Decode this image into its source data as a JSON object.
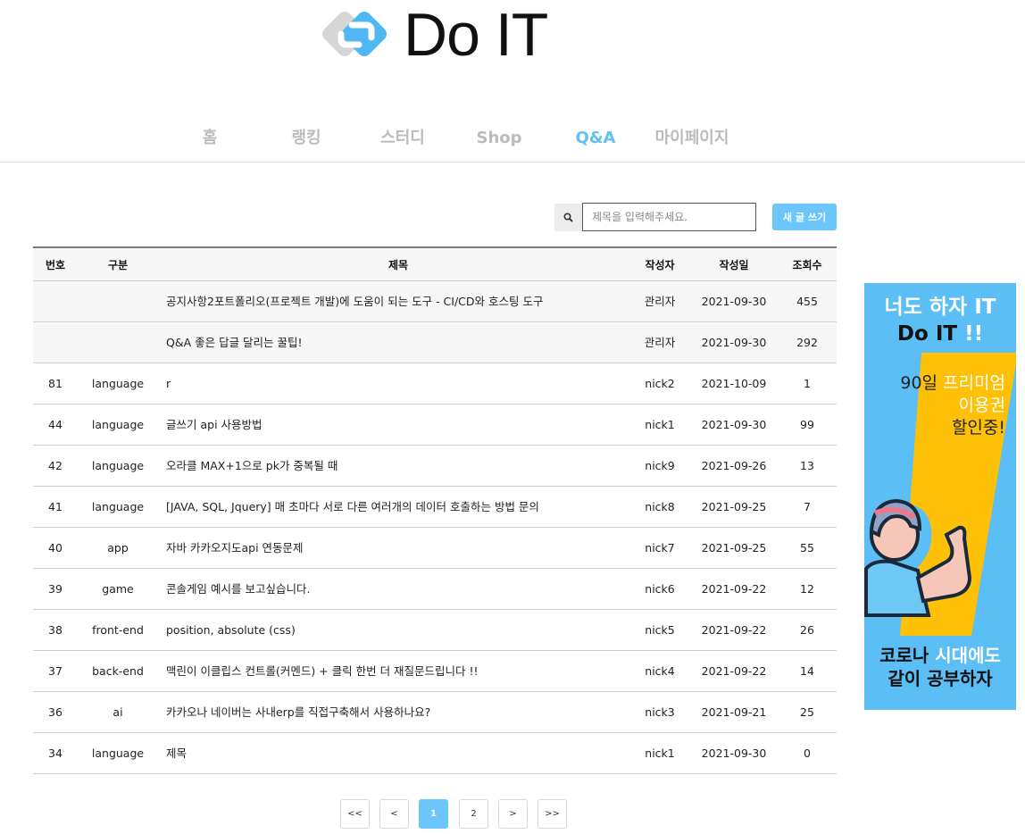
{
  "brand": {
    "name": "Do IT",
    "accent": "#60c0f7",
    "button": "#6cc6fb"
  },
  "nav": {
    "items": [
      {
        "label": "홈"
      },
      {
        "label": "랭킹"
      },
      {
        "label": "스터디"
      },
      {
        "label": "Shop"
      },
      {
        "label": "Q&A",
        "active": true
      },
      {
        "label": "마이페이지"
      }
    ]
  },
  "search": {
    "placeholder": "제목을 입력해주세요.",
    "value": "",
    "icon": "search-icon"
  },
  "write_button": {
    "label": "새 글 쓰기"
  },
  "table": {
    "headers": {
      "no": "번호",
      "category": "구분",
      "title": "제목",
      "writer": "작성자",
      "date": "작성일",
      "views": "조회수"
    },
    "notices": [
      {
        "no": "",
        "category": "",
        "title": "공지사항2포트폴리오(프로젝트 개발)에 도움이 되는 도구 - CI/CD와 호스팅 도구",
        "writer": "관리자",
        "date": "2021-09-30",
        "views": "455"
      },
      {
        "no": "",
        "category": "",
        "title": "Q&A 좋은 답글 달리는 꿀팁!",
        "writer": "관리자",
        "date": "2021-09-30",
        "views": "292"
      }
    ],
    "rows": [
      {
        "no": "81",
        "category": "language",
        "title": "r",
        "writer": "nick2",
        "date": "2021-10-09",
        "views": "1"
      },
      {
        "no": "44",
        "category": "language",
        "title": "글쓰기 api 사용방법",
        "writer": "nick1",
        "date": "2021-09-30",
        "views": "99"
      },
      {
        "no": "42",
        "category": "language",
        "title": "오라클 MAX+1으로 pk가 중복될 때",
        "writer": "nick9",
        "date": "2021-09-26",
        "views": "13"
      },
      {
        "no": "41",
        "category": "language",
        "title": "[JAVA, SQL, Jquery] 매 초마다 서로 다른 여러개의 데이터 호출하는 방법 문의",
        "writer": "nick8",
        "date": "2021-09-25",
        "views": "7"
      },
      {
        "no": "40",
        "category": "app",
        "title": "자바 카카오지도api 연동문제",
        "writer": "nick7",
        "date": "2021-09-25",
        "views": "55"
      },
      {
        "no": "39",
        "category": "game",
        "title": "콘솔게임 예시를 보고싶습니다.",
        "writer": "nick6",
        "date": "2021-09-22",
        "views": "12"
      },
      {
        "no": "38",
        "category": "front-end",
        "title": "position, absolute (css)",
        "writer": "nick5",
        "date": "2021-09-22",
        "views": "26"
      },
      {
        "no": "37",
        "category": "back-end",
        "title": "맥린이 이클립스 컨트롤(커멘드) + 클릭 한번 더 재질문드립니다 !!",
        "writer": "nick4",
        "date": "2021-09-22",
        "views": "14"
      },
      {
        "no": "36",
        "category": "ai",
        "title": "카카오나 네이버는 사내erp를 직접구축해서 사용하나요?",
        "writer": "nick3",
        "date": "2021-09-21",
        "views": "25"
      },
      {
        "no": "34",
        "category": "language",
        "title": "제목",
        "writer": "nick1",
        "date": "2021-09-30",
        "views": "0"
      }
    ]
  },
  "pagination": {
    "first": "<<",
    "prev": "<",
    "pages": [
      {
        "label": "1",
        "active": true
      },
      {
        "label": "2",
        "active": false
      }
    ],
    "next": ">",
    "last": ">>"
  },
  "banner": {
    "line1": "너도 하자 IT",
    "line2_a": "Do IT",
    "line2_b": "!!",
    "promo_a": "90일",
    "promo_b": "프리미엄",
    "promo_c": "이용권",
    "promo_d": "할인중!",
    "bottom_a": "코로나",
    "bottom_b": "시대에도",
    "bottom_c": "같이 공부하자"
  }
}
